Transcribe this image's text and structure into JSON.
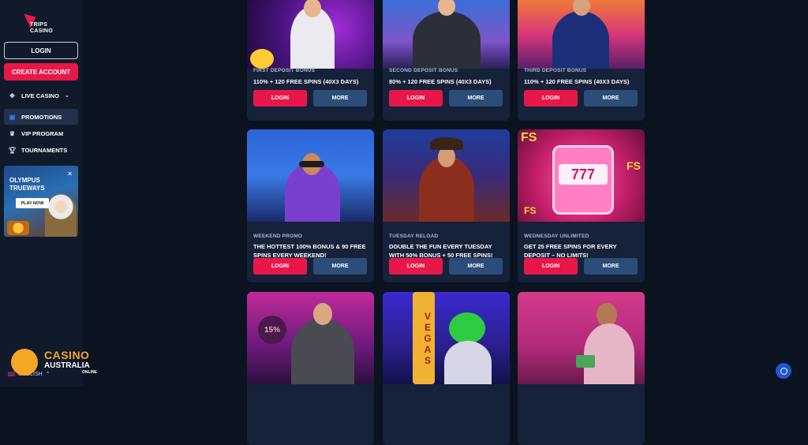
{
  "brand": {
    "line1": "TRIPS",
    "line2": "CASINO"
  },
  "sidebar": {
    "login_label": "LOGIN",
    "create_label": "CREATE ACCOUNT",
    "items": [
      {
        "label": "LIVE CASINO",
        "icon": "live-casino-icon"
      },
      {
        "label": "PROMOTIONS",
        "icon": "promotions-icon"
      },
      {
        "label": "VIP PROGRAM",
        "icon": "crown-icon"
      },
      {
        "label": "TOURNAMENTS",
        "icon": "trophy-icon"
      }
    ],
    "promo": {
      "title": "OLYMPUS TRUEWAYS",
      "play_label": "PLAY NOW"
    },
    "language": "ENGLISH"
  },
  "cards": [
    {
      "label": "FIRST DEPOSIT BONUS",
      "text": "110% + 120 FREE SPINS (40X3 DAYS)",
      "login": "LOGIN",
      "more": "MORE"
    },
    {
      "label": "SECOND DEPOSIT BONUS",
      "text": "80% + 120 FREE SPINS (40X3 DAYS)",
      "login": "LOGIN",
      "more": "MORE"
    },
    {
      "label": "THIRD DEPOSIT BONUS",
      "text": "110% + 120 FREE SPINS (40X3 DAYS)",
      "login": "LOGIN",
      "more": "MORE"
    },
    {
      "label": "WEEKEND PROMO",
      "text": "THE HOTTEST 100% BONUS & 90 FREE SPINS EVERY WEEKEND!",
      "login": "LOGIN",
      "more": "MORE"
    },
    {
      "label": "TUESDAY RELOAD",
      "text": "DOUBLE THE FUN EVERY TUESDAY WITH 50% BONUS + 50 FREE SPINS!",
      "login": "LOGIN",
      "more": "MORE"
    },
    {
      "label": "WEDNESDAY UNLIMITED",
      "text": "GET 25 FREE SPINS FOR EVERY DEPOSIT – NO LIMITS!",
      "login": "LOGIN",
      "more": "MORE"
    }
  ],
  "images": {
    "vegas": "VEGAS",
    "fs": "FS",
    "slot": "777",
    "pct": "15%"
  },
  "watermark": {
    "line1": "CASINO",
    "line2": "AUSTRALIA",
    "line3": "ONLINE"
  },
  "colors": {
    "accent": "#e8174a",
    "secondary": "#2c4d78",
    "background": "#0b1220",
    "card": "#16213a"
  }
}
